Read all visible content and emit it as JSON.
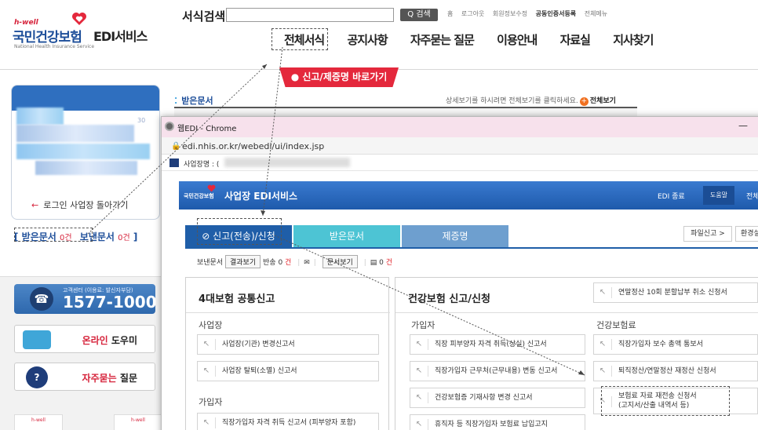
{
  "portal": {
    "logo_small": "h-well",
    "logo_main": "국민건강보험",
    "logo_sub": "National Health Insurance Service",
    "edi_title": "EDI서비스",
    "search_label": "서식검색",
    "search_button": "Q 검색",
    "util_links": [
      "홈",
      "로그아웃",
      "회원정보수정",
      "공동인증서등록",
      "전체메뉴"
    ],
    "gnb": [
      "전체서식",
      "공지사항",
      "자주묻는 질문",
      "이용안내",
      "자료실",
      "지사찾기"
    ],
    "banner": "● 신고/제증명 바로가기",
    "received_docs_label": "받은문서",
    "detail_hint": "상세보기를 하시려면 전체보기를 클릭하세요.",
    "detail_hint_button": "전체보기",
    "login_return": "로그인 사업장 돌아가기",
    "login_return_arrow": "←",
    "inbox_label": "받은문서",
    "inbox_count": "0건",
    "outbox_label": "보낸문서",
    "outbox_count": "0건",
    "bracket_open": "[",
    "bracket_close": "]",
    "call_small": "고객센터 (이용료: 발신자부담)",
    "call_number": "1577-1000",
    "online_help_red": "온라인",
    "online_help": "도우미",
    "faq_red": "자주묻는",
    "faq": "질문",
    "bottom_logo": "h-well",
    "partial_digits": "30"
  },
  "popup": {
    "window_title": "웹EDI - Chrome",
    "minimize": "—",
    "url": "edi.nhis.or.kr/webedi/ui/index.jsp",
    "biz_label": "사업장명 : (",
    "header_logo": "국민건강보험",
    "header_title": "사업장 EDI서비스",
    "edi_end": "EDI 종료",
    "help": "도움말",
    "more": "전체",
    "tabs": [
      "⊘ 신고(전송)/신청",
      "받은문서",
      "제증명"
    ],
    "file_report": "파일신고 >",
    "env_settings": "환경설",
    "sent_label": "보낸문서",
    "result_view": "결과보기",
    "return_label": "반송",
    "return_count": "0",
    "return_unit": "건",
    "doc_view": "문서보기",
    "doc_count": "0",
    "doc_unit": "건",
    "left_panel": {
      "title": "4대보험 공통신고",
      "sections": [
        {
          "label": "사업장",
          "items": [
            "사업장(기관) 변경신고서",
            "사업장 탈퇴(소멸) 신고서"
          ]
        },
        {
          "label": "가입자",
          "items": [
            "직장가입자 자격 취득 신고서 (피부양자 포함)"
          ]
        }
      ]
    },
    "right_panel": {
      "title": "건강보험 신고/신청",
      "top_item": "연말정산 10회 분할납부 취소 신청서",
      "col1_label": "가입자",
      "col1_items": [
        "직장 피부양자 자격 취득(상실) 신고서",
        "직장가입자 근무처(근무내용) 변동 신고서",
        "건강보험증 기재사항 변경 신고서",
        "휴직자 등 직장가입자 보험료 납입고지"
      ],
      "col2_label": "건강보험료",
      "col2_items": [
        "직장가입자 보수 총액 통보서",
        "퇴직정산/연말정산 재정산 신청서",
        "보험료 자료 재전송 신청서",
        "(고지서/산출 내역서 등)"
      ]
    }
  },
  "colors": {
    "brand_blue": "#1e4f9a",
    "brand_red": "#d6233b",
    "tab_active": "#1f5ea8",
    "tab_cyan": "#4dc4d4",
    "tab_mid": "#6e9fcf",
    "titlebar_pink": "#f7e1ec"
  }
}
